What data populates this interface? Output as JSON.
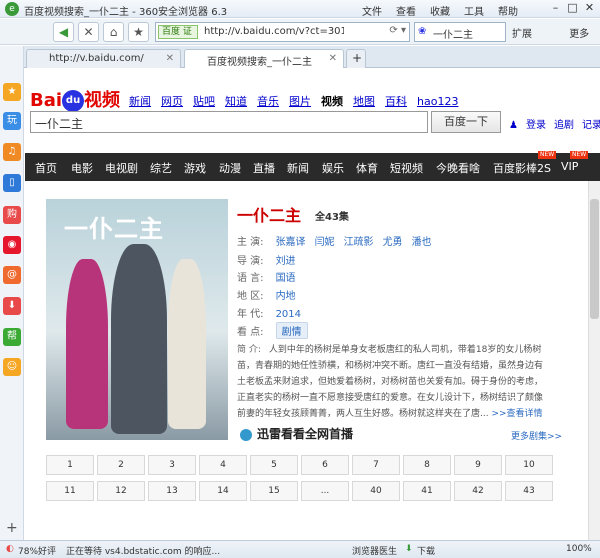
{
  "window": {
    "title": "百度视频搜索_一仆二主 - 360安全浏览器 6.3",
    "menus": [
      "文件",
      "查看",
      "收藏",
      "工具",
      "帮助"
    ]
  },
  "toolbar": {
    "badge": "百度 证",
    "url": "http://v.baidu.com/v?ct=30189",
    "search_query": "一仆二主",
    "extensions": "扩展",
    "more": "更多"
  },
  "tabs": [
    {
      "label": "http://v.baidu.com/"
    },
    {
      "label": "百度视频搜索_一仆二主"
    }
  ],
  "sidebar": [
    {
      "icon": "star-icon",
      "label": "★",
      "color": "#f5a623"
    },
    {
      "icon": "play-icon",
      "label": "玩",
      "color": "#3a8ee6"
    },
    {
      "icon": "music-icon",
      "label": "♫",
      "color": "#f08a24"
    },
    {
      "icon": "book-icon",
      "label": "▯",
      "color": "#2f7ad8"
    },
    {
      "icon": "shop-icon",
      "label": "购",
      "color": "#e84a4a"
    },
    {
      "icon": "weibo-icon",
      "label": "◉",
      "color": "#e6162d"
    },
    {
      "icon": "mail-icon",
      "label": "@",
      "color": "#f06a30"
    },
    {
      "icon": "download-icon",
      "label": "⬇",
      "color": "#e84a4a"
    },
    {
      "icon": "help-icon",
      "label": "帮",
      "color": "#3aaa35"
    },
    {
      "icon": "smile-icon",
      "label": "☺",
      "color": "#f5a623"
    }
  ],
  "baidu": {
    "logo_a": "Bai",
    "logo_du": "du",
    "logo_b": "视频",
    "nav": [
      "新闻",
      "网页",
      "贴吧",
      "知道",
      "音乐",
      "图片",
      "视频",
      "地图",
      "百科",
      "hao123"
    ],
    "current": "视频",
    "query": "一仆二主",
    "search_button": "百度一下",
    "links": [
      "登录",
      "追剧",
      "记录"
    ]
  },
  "categories": [
    "首页",
    "电影",
    "电视剧",
    "综艺",
    "游戏",
    "动漫",
    "直播",
    "新闻",
    "娱乐",
    "体育",
    "短视频",
    "今晚看啥",
    "百度影棒2S",
    "VIP"
  ],
  "new_badge": "NEW",
  "show": {
    "poster_title": "一仆二主",
    "title": "一仆二主",
    "episodes": "全43集",
    "cast_key": "主 演:",
    "cast": [
      "张嘉译",
      "闫妮",
      "江疏影",
      "尤勇",
      "潘也"
    ],
    "director_key": "导 演:",
    "director": "刘进",
    "language_key": "语 言:",
    "language": "国语",
    "region_key": "地 区:",
    "region": "内地",
    "year_key": "年 代:",
    "year": "2014",
    "genre_key": "看 点:",
    "genre": "剧情",
    "desc_key": "简 介:",
    "description": "人到中年的杨树是单身女老板唐红的私人司机，带着18岁的女儿杨树苗，青春期的她任性骄横，和杨树冲突不断。唐红一直没有结婚，虽然身边有土老板孟来财追求，但她爱着杨树，对杨树苗也关爱有加。碍于身份的考虑，正直老实的杨树一直不愿意接受唐红的爱意。在女儿设计下，杨树结识了颇像前妻的年轻女孩顾菁菁，两人互生好感。杨树就这样夹在了唐...",
    "more": ">>查看详情"
  },
  "player": {
    "name": "迅雷看看全网首播",
    "more": "更多剧集>>"
  },
  "episodes": [
    "1",
    "2",
    "3",
    "4",
    "5",
    "6",
    "7",
    "8",
    "9",
    "10",
    "11",
    "12",
    "13",
    "14",
    "15",
    "...",
    "40",
    "41",
    "42",
    "43"
  ],
  "status": {
    "rating": "78%好评",
    "loading": "正在等待 vs4.bdstatic.com 的响应...",
    "doctor": "浏览器医生",
    "download": "下载",
    "zoom": "100%"
  }
}
